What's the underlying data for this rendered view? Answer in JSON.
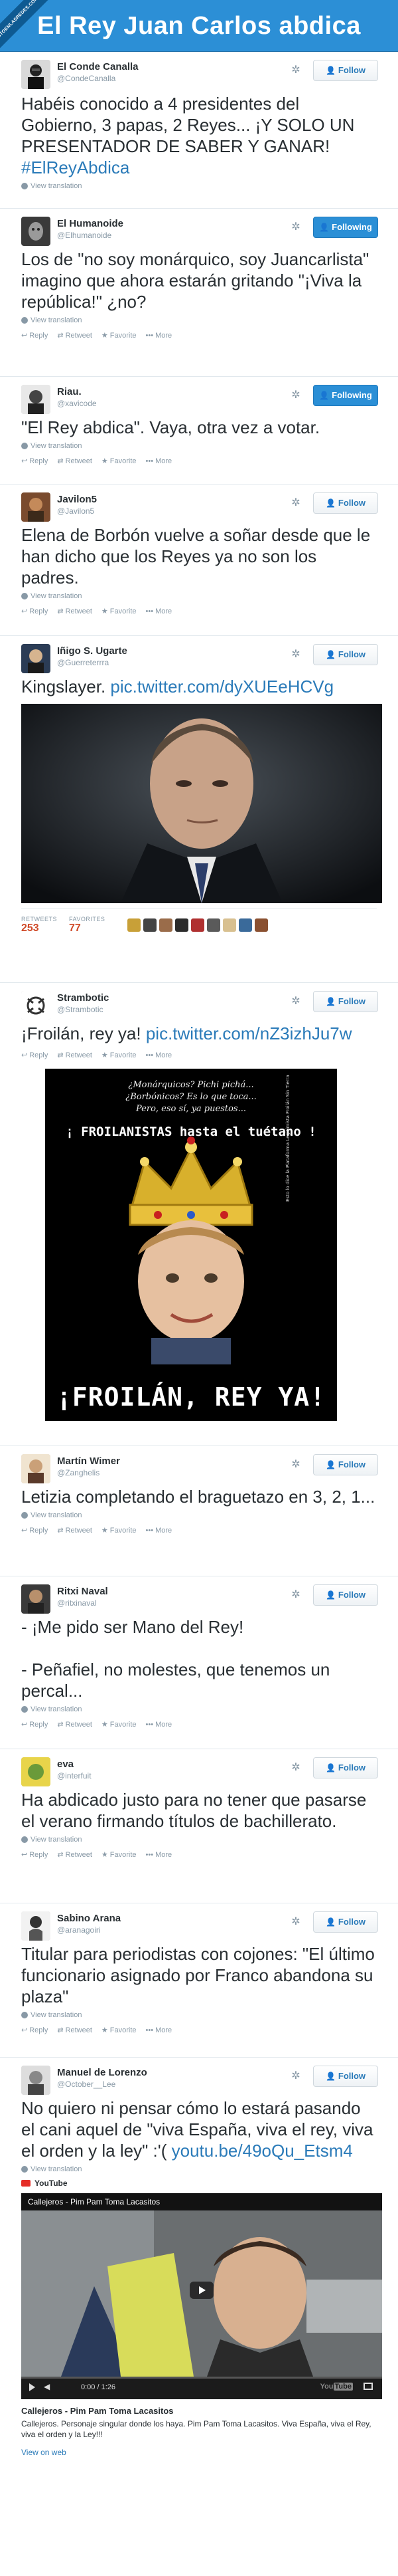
{
  "site": {
    "title": "El Rey Juan Carlos abdica",
    "ribbon": "VISTOENLASREDES.COM"
  },
  "ui": {
    "view_translation": "View translation",
    "reply": "Reply",
    "retweet": "Retweet",
    "favorite": "Favorite",
    "more": "More",
    "follow": "Follow",
    "following": "Following",
    "retweets_label": "RETWEETS",
    "favorites_label": "FAVORITES",
    "view_on_web": "View on web",
    "youtube": "YouTube"
  },
  "tweets": [
    {
      "name": "El Conde Canalla",
      "handle": "@CondeCanalla",
      "text": "Habéis conocido a 4 presidentes del Gobierno, 3 papas, 2 Reyes... ¡Y SOLO UN PRESENTADOR DE SABER Y GANAR!",
      "hashtag": "#ElReyAbdica",
      "following": false
    },
    {
      "name": "El Humanoide",
      "handle": "@Elhumanoide",
      "text": "Los de \"no soy monárquico,  soy Juancarlista\" imagino que ahora estarán gritando \"¡Viva la república!\" ¿no?",
      "following": true
    },
    {
      "name": "Riau.",
      "handle": "@xavicode",
      "text": "\"El Rey abdica\". Vaya, otra vez a votar.",
      "following": true
    },
    {
      "name": "Javilon5",
      "handle": "@Javilon5",
      "text": "Elena de Borbón vuelve a soñar desde que le han dicho que los Reyes ya no son los padres.",
      "following": false
    },
    {
      "name": "Iñigo S. Ugarte",
      "handle": "@Guerreterrra",
      "text": "Kingslayer.",
      "link": "pic.twitter.com/dyXUEeHCVg",
      "retweets": "253",
      "favorites": "77",
      "following": false
    },
    {
      "name": "Strambotic",
      "handle": "@Strambotic",
      "text": "¡Froilán, rey ya!",
      "link": "pic.twitter.com/nZ3izhJu7w",
      "following": false,
      "poster": {
        "line1": "¿Monárquicos? Pichi pichá...",
        "line2": "¿Borbónicos? Es lo que toca...",
        "line3": "Pero, eso sí, ya puestos...",
        "banner": "¡ FROILANISTAS hasta el tuétano !",
        "side": "Esto lo dice la Plataforma Legitimista Froilán Sin Tierra",
        "bottom": "¡FROILÁN, REY YA!"
      }
    },
    {
      "name": "Martín Wimer",
      "handle": "@Zanghelis",
      "text": "Letizia completando el braguetazo en 3, 2, 1...",
      "following": false
    },
    {
      "name": "Ritxi Naval",
      "handle": "@ritxinaval",
      "text": "- ¡Me pido ser Mano del Rey!\n\n- Peñafiel, no molestes, que tenemos un percal...",
      "following": false
    },
    {
      "name": "eva",
      "handle": "@interfuit",
      "text": "Ha abdicado justo para no tener que pasarse el verano firmando títulos de bachillerato.",
      "following": false
    },
    {
      "name": "Sabino Arana",
      "handle": "@aranagoiri",
      "text": "Titular para periodistas con cojones: \"El último funcionario asignado por Franco abandona su plaza\"",
      "following": false
    },
    {
      "name": "Manuel de Lorenzo",
      "handle": "@October__Lee",
      "text": "No quiero ni pensar cómo lo estará pasando el cani aquel de \"viva España, viva el rey, viva el orden y la ley\" :'(",
      "link": "youtu.be/49oQu_Etsm4",
      "following": false,
      "video": {
        "title_bar": "Callejeros - Pim Pam Toma Lacasitos",
        "time": "0:00 / 1:26",
        "card_title": "Callejeros - Pim Pam Toma Lacasitos",
        "card_desc": "Callejeros. Personaje singular donde los haya. Pim Pam Toma Lacasitos. Viva España, viva el Rey, viva el orden y la Ley!!!"
      }
    }
  ],
  "colors": {
    "header": "#2c8fd6",
    "link": "#2b7bb9",
    "following": "#2b8fd6"
  }
}
